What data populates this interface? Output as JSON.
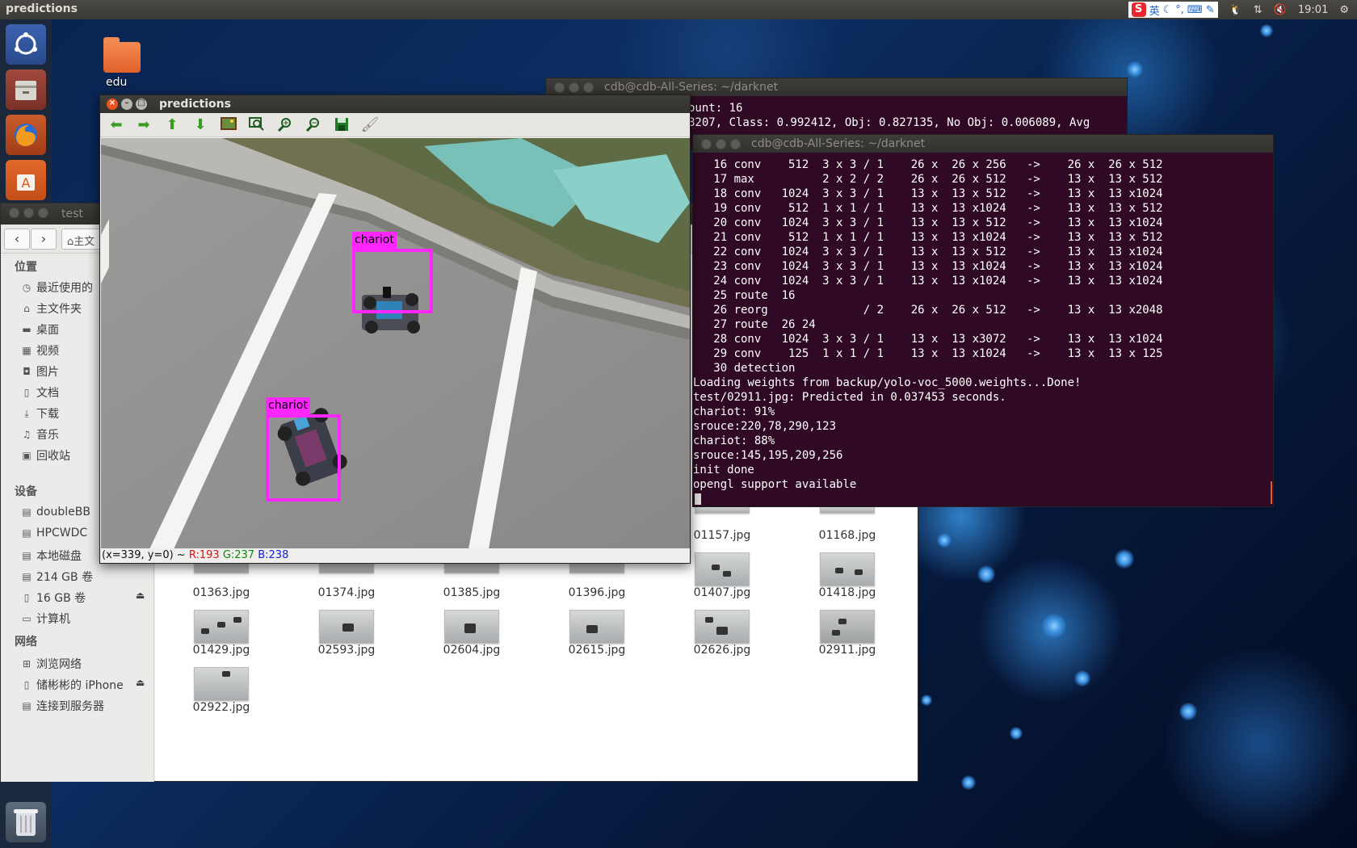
{
  "topbar": {
    "title": "predictions",
    "ime_label": "英",
    "ime_logo": "S",
    "clock": "19:01"
  },
  "desktop": {
    "folder_label": "edu"
  },
  "launcher": {
    "items": [
      "ubuntu-icon",
      "files-icon",
      "firefox-icon",
      "software-center-icon",
      "trash-icon"
    ]
  },
  "file_manager": {
    "title": "test",
    "breadcrumb": "主文",
    "sidebar": {
      "places_header": "位置",
      "places": [
        "最近使用的",
        "主文件夹",
        "桌面",
        "视频",
        "图片",
        "文档",
        "下载",
        "音乐",
        "回收站"
      ],
      "devices_header": "设备",
      "devices": [
        "doubleBB",
        "HPCWDC",
        "本地磁盘",
        "214 GB 卷",
        "16 GB 卷",
        "计算机"
      ],
      "network_header": "网络",
      "network": [
        "浏览网络",
        "储彬彬的 iPhone",
        "连接到服务器"
      ]
    },
    "files": [
      "01157.jpg",
      "01168.jpg",
      "01363.jpg",
      "01374.jpg",
      "01385.jpg",
      "01396.jpg",
      "01407.jpg",
      "01418.jpg",
      "01429.jpg",
      "02593.jpg",
      "02604.jpg",
      "02615.jpg",
      "02626.jpg",
      "02911.jpg",
      "02922.jpg"
    ]
  },
  "terminal_back": {
    "title": "cdb@cdb-All-Series: ~/darknet",
    "lines": [
      "ount: 16",
      "8207, Class: 0.992412, Obj: 0.827135, No Obj: 0.006089, Avg"
    ]
  },
  "terminal_front": {
    "title": "cdb@cdb-All-Series: ~/darknet",
    "lines": [
      "   16 conv    512  3 x 3 / 1    26 x  26 x 256   ->    26 x  26 x 512",
      "   17 max          2 x 2 / 2    26 x  26 x 512   ->    13 x  13 x 512",
      "   18 conv   1024  3 x 3 / 1    13 x  13 x 512   ->    13 x  13 x1024",
      "   19 conv    512  1 x 1 / 1    13 x  13 x1024   ->    13 x  13 x 512",
      "   20 conv   1024  3 x 3 / 1    13 x  13 x 512   ->    13 x  13 x1024",
      "   21 conv    512  1 x 1 / 1    13 x  13 x1024   ->    13 x  13 x 512",
      "   22 conv   1024  3 x 3 / 1    13 x  13 x 512   ->    13 x  13 x1024",
      "   23 conv   1024  3 x 3 / 1    13 x  13 x1024   ->    13 x  13 x1024",
      "   24 conv   1024  3 x 3 / 1    13 x  13 x1024   ->    13 x  13 x1024",
      "   25 route  16",
      "   26 reorg              / 2    26 x  26 x 512   ->    13 x  13 x2048",
      "   27 route  26 24",
      "   28 conv   1024  3 x 3 / 1    13 x  13 x3072   ->    13 x  13 x1024",
      "   29 conv    125  1 x 1 / 1    13 x  13 x1024   ->    13 x  13 x 125",
      "   30 detection",
      "Loading weights from backup/yolo-voc_5000.weights...Done!",
      "test/02911.jpg: Predicted in 0.037453 seconds.",
      "chariot: 91%",
      "srouce:220,78,290,123",
      "chariot: 88%",
      "srouce:145,195,209,256",
      "init done",
      "opengl support available"
    ]
  },
  "predictions": {
    "title": "predictions",
    "toolbar": [
      "arrow-left-icon",
      "arrow-right-icon",
      "arrow-up-icon",
      "arrow-down-icon",
      "image-icon",
      "zoom-fit-icon",
      "zoom-in-icon",
      "zoom-out-icon",
      "save-icon",
      "brush-icon"
    ],
    "detections": [
      {
        "label": "chariot"
      },
      {
        "label": "chariot"
      }
    ],
    "status": {
      "coords": "(x=339, y=0) ~",
      "r": "R:193",
      "g": "G:237",
      "b": "B:238"
    }
  }
}
